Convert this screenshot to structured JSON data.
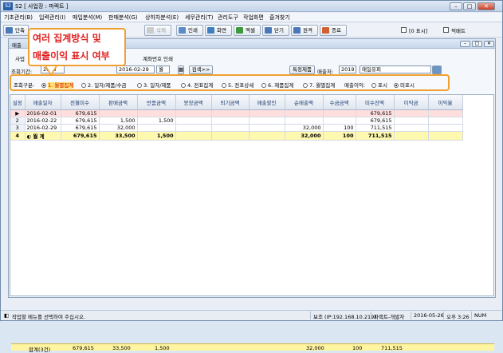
{
  "window": {
    "app_icon": "S2",
    "title": "S2 [ 사업장 : 파렉트 ]"
  },
  "menu": [
    "기초관리(B)",
    "입력관리(I)",
    "매입분석(M)",
    "판매분석(G)",
    "상하차분석(E)",
    "세무관리(T)",
    "관리도구",
    "작업화면",
    "즐겨찾기"
  ],
  "toolbar": {
    "left_button": "단축",
    "delete": "삭제",
    "print": "인쇄",
    "screen": "화면",
    "excel": "엑셀",
    "close": "닫기",
    "home": "원격",
    "exit": "종료",
    "check1": "[0 표시]",
    "check2": "찍배트"
  },
  "inner": {
    "title": "매출",
    "tab1": "사업",
    "print_link": "계좌번호 인쇄",
    "search_label": "조회기간:",
    "date_from": "2016",
    "date_to": "2016-02-29",
    "unit": "월",
    "search_btn": "검색>>",
    "special_btn": "특정제품",
    "sales_label": "매출처:",
    "sales_code": "2019",
    "sales_name": "매일유퍼"
  },
  "options": {
    "group_label": "조회구분:",
    "items": [
      "1. 월별집계",
      "2. 일자/제품/수금",
      "3. 일자/제품",
      "4. 전표집계",
      "5. 전표상세",
      "6. 제품집계",
      "7. 월별집계"
    ],
    "selected": 0,
    "profit_label": "매출이익:",
    "profit_items": [
      "표시",
      "미표시"
    ],
    "profit_selected": 1
  },
  "callout": {
    "line1": "여러 집계방식 및",
    "line2": "매출이익 표시 여부"
  },
  "table": {
    "headers": [
      "설정",
      "매출일자",
      "전월미수",
      "판매금액",
      "반품금액",
      "봉장금액",
      "퇴기금액",
      "매출할인",
      "순매출액",
      "수금금액",
      "미수잔액",
      "이익금",
      "이익율"
    ],
    "rows": [
      {
        "no": "▶",
        "date": "2016-02-01",
        "prev": "679,615",
        "sale": "",
        "ret": "",
        "c4": "",
        "c5": "",
        "c6": "",
        "net": "",
        "coll": "",
        "bal": "679,615"
      },
      {
        "no": "2",
        "date": "2016-02-22",
        "prev": "679,615",
        "sale": "1,500",
        "ret": "1,500",
        "c4": "",
        "c5": "",
        "c6": "",
        "net": "",
        "coll": "",
        "bal": "679,615"
      },
      {
        "no": "3",
        "date": "2016-02-29",
        "prev": "679,615",
        "sale": "32,000",
        "ret": "",
        "c4": "",
        "c5": "",
        "c6": "",
        "net": "32,000",
        "coll": "100",
        "bal": "711,515"
      },
      {
        "no": "4",
        "date": "◐ 월 계",
        "prev": "679,615",
        "sale": "33,500",
        "ret": "1,500",
        "c4": "",
        "c5": "",
        "c6": "",
        "net": "32,000",
        "coll": "100",
        "bal": "711,515"
      }
    ],
    "total": {
      "label": "합계(3건)",
      "prev": "679,615",
      "sale": "33,500",
      "ret": "1,500",
      "net": "32,000",
      "coll": "100",
      "bal": "711,515"
    }
  },
  "status": {
    "hint": "작업할 메뉴를 선택하여 주십시오.",
    "ip": "보조 (IP:192.168.10.219)",
    "company": "파렉트-개발자",
    "date": "2016-05-26",
    "time": "오후 3:26",
    "num": "NUM"
  }
}
